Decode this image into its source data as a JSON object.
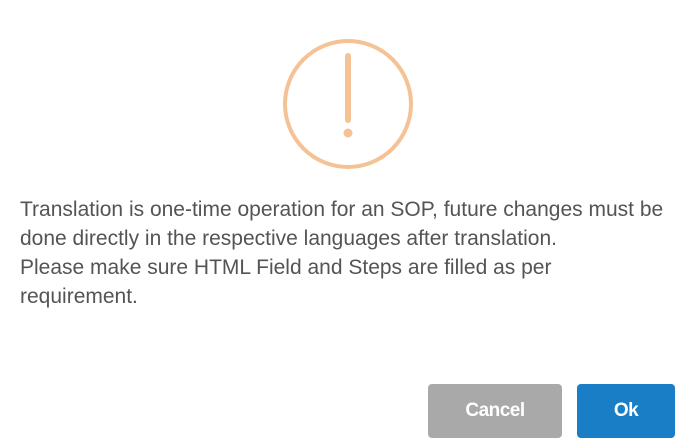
{
  "dialog": {
    "icon": "warning-circle-icon",
    "icon_color": "#f5c295",
    "message_lines": [
      "Translation is one-time operation for an SOP, future changes must be done directly in the respective languages after translation.",
      "Please make sure HTML Field and Steps are filled as per requirement."
    ],
    "buttons": {
      "cancel_label": "Cancel",
      "ok_label": "Ok"
    },
    "colors": {
      "cancel_bg": "#a9a9a9",
      "ok_bg": "#1a7ec6",
      "text": "#545454"
    }
  }
}
